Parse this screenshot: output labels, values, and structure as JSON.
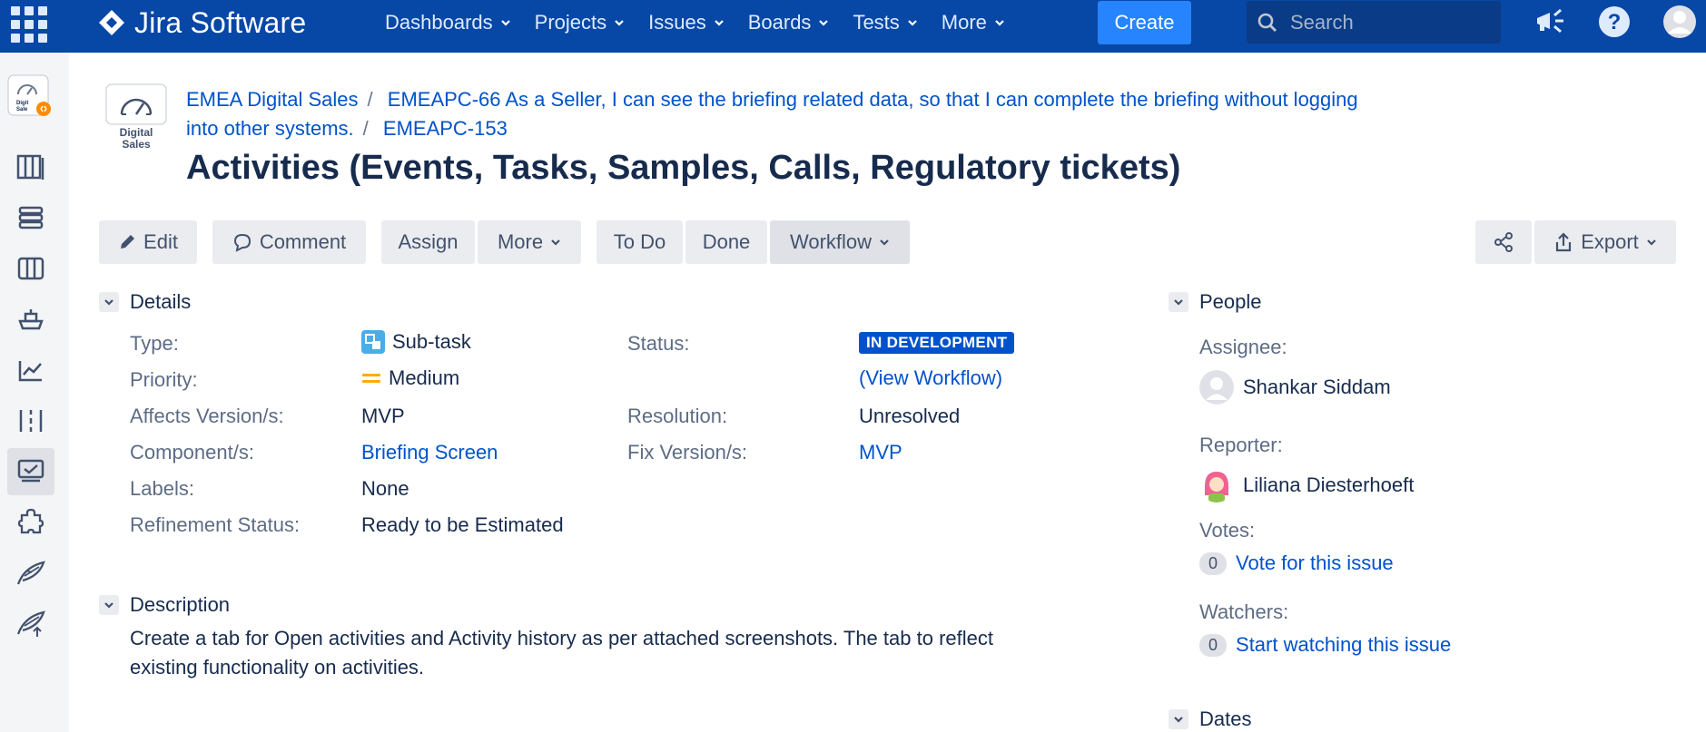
{
  "nav": {
    "logo": "Jira Software",
    "items": [
      "Dashboards",
      "Projects",
      "Issues",
      "Boards",
      "Tests",
      "More"
    ],
    "create": "Create",
    "search_placeholder": "Search"
  },
  "project": {
    "avatar_text_1": "Digital",
    "avatar_text_2": "Sales",
    "mini_text": "Digit Sale"
  },
  "breadcrumb": {
    "project": "EMEA Digital Sales",
    "parent_line1": "EMEAPC-66 As a Seller, I can see the briefing related data, so that I can complete the briefing without logging",
    "parent_line2": "into other systems.",
    "issue_key": "EMEAPC-153"
  },
  "issue": {
    "title": "Activities (Events, Tasks, Samples, Calls, Regulatory tickets)"
  },
  "toolbar": {
    "edit": "Edit",
    "comment": "Comment",
    "assign": "Assign",
    "more": "More",
    "todo": "To Do",
    "done": "Done",
    "workflow": "Workflow",
    "export": "Export"
  },
  "details": {
    "heading": "Details",
    "type_label": "Type:",
    "type_value": "Sub-task",
    "priority_label": "Priority:",
    "priority_value": "Medium",
    "affects_label": "Affects Version/s:",
    "affects_value": "MVP",
    "component_label": "Component/s:",
    "component_value": "Briefing Screen",
    "labels_label": "Labels:",
    "labels_value": "None",
    "refinement_label": "Refinement Status:",
    "refinement_value": "Ready to be Estimated",
    "status_label": "Status:",
    "status_value": "IN DEVELOPMENT",
    "view_workflow_open": "(",
    "view_workflow": "View Workflow",
    "view_workflow_close": ")",
    "resolution_label": "Resolution:",
    "resolution_value": "Unresolved",
    "fix_label": "Fix Version/s:",
    "fix_value": "MVP"
  },
  "description": {
    "heading": "Description",
    "line1": "Create a tab for Open activities and Activity history as per attached screenshots. The tab to reflect",
    "line2": "existing functionality on activities."
  },
  "people": {
    "heading": "People",
    "assignee_label": "Assignee:",
    "assignee": "Shankar Siddam",
    "reporter_label": "Reporter:",
    "reporter": "Liliana Diesterhoeft",
    "votes_label": "Votes:",
    "votes_count": "0",
    "vote_link": "Vote for this issue",
    "watchers_label": "Watchers:",
    "watchers_count": "0",
    "watch_link": "Start watching this issue"
  },
  "dates": {
    "heading": "Dates"
  },
  "colors": {
    "nav_bg": "#0747a6",
    "accent": "#0052cc",
    "create": "#2684ff",
    "priority_medium": "#ffab00"
  }
}
